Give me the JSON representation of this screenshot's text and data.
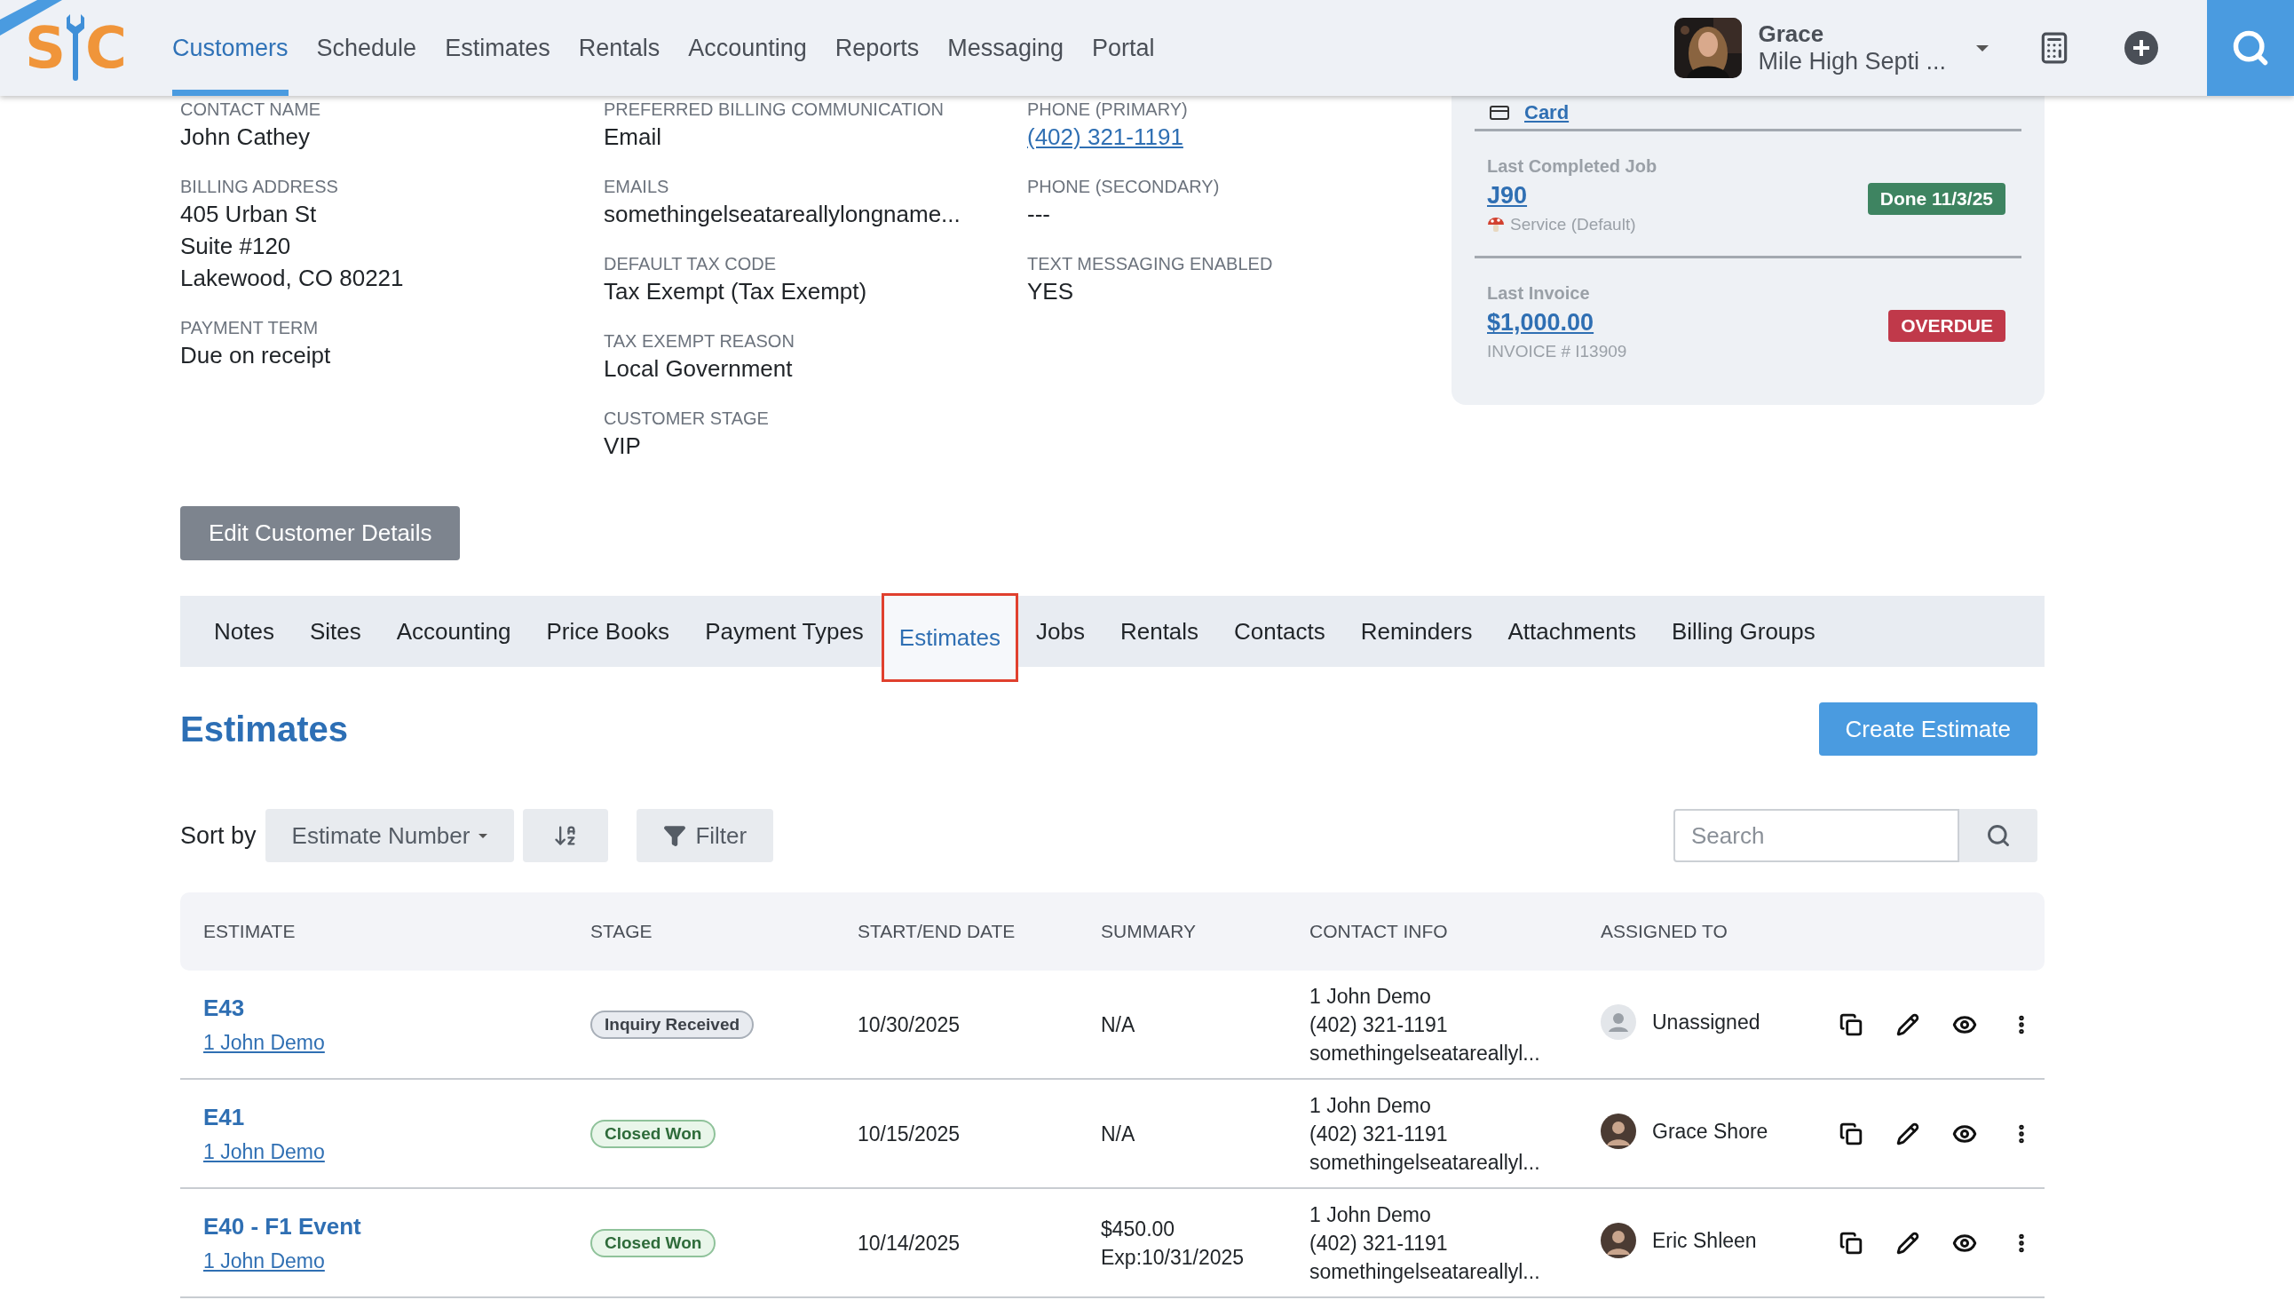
{
  "logo": {
    "left": "S",
    "right": "C"
  },
  "nav": {
    "items": [
      {
        "label": "Customers",
        "selected": true
      },
      {
        "label": "Schedule",
        "selected": false
      },
      {
        "label": "Estimates",
        "selected": false
      },
      {
        "label": "Rentals",
        "selected": false
      },
      {
        "label": "Accounting",
        "selected": false
      },
      {
        "label": "Reports",
        "selected": false
      },
      {
        "label": "Messaging",
        "selected": false
      },
      {
        "label": "Portal",
        "selected": false
      }
    ],
    "user": {
      "name": "Grace",
      "company": "Mile High Septi ..."
    }
  },
  "details": {
    "columns": [
      [
        {
          "label": "CONTACT NAME",
          "kind": "text",
          "lines": [
            "John Cathey"
          ]
        },
        {
          "label": "BILLING ADDRESS",
          "kind": "text",
          "lines": [
            "405 Urban St",
            "Suite #120",
            "Lakewood, CO 80221"
          ]
        },
        {
          "label": "PAYMENT TERM",
          "kind": "text",
          "lines": [
            "Due on receipt"
          ]
        }
      ],
      [
        {
          "label": "PREFERRED BILLING COMMUNICATION",
          "kind": "text",
          "lines": [
            "Email"
          ]
        },
        {
          "label": "EMAILS",
          "kind": "text",
          "lines": [
            "somethingelseatareallylongname..."
          ]
        },
        {
          "label": "DEFAULT TAX CODE",
          "kind": "text",
          "lines": [
            "Tax Exempt (Tax Exempt)"
          ]
        },
        {
          "label": "TAX EXEMPT REASON",
          "kind": "text",
          "lines": [
            "Local Government"
          ]
        },
        {
          "label": "CUSTOMER STAGE",
          "kind": "text",
          "lines": [
            "VIP"
          ]
        }
      ],
      [
        {
          "label": "PHONE (PRIMARY)",
          "kind": "link",
          "lines": [
            "(402) 321-1191"
          ]
        },
        {
          "label": "PHONE (SECONDARY)",
          "kind": "text",
          "lines": [
            "---"
          ]
        },
        {
          "label": "TEXT MESSAGING ENABLED",
          "kind": "text",
          "lines": [
            "YES"
          ]
        }
      ]
    ]
  },
  "summary_panel": {
    "card_link": "Card",
    "sections": [
      {
        "title": "Last Completed Job",
        "link": "J90",
        "detail": "Service (Default)",
        "kind": "job",
        "badge": {
          "label": "Done 11/3/25",
          "kind": "success"
        }
      },
      {
        "title": "Last Invoice",
        "link": "$1,000.00",
        "detail": "INVOICE # I13909",
        "kind": "plain",
        "badge": {
          "label": "OVERDUE",
          "kind": "danger"
        }
      }
    ]
  },
  "edit_button": "Edit Customer Details",
  "tabs": [
    {
      "label": "Notes",
      "selected": false
    },
    {
      "label": "Sites",
      "selected": false
    },
    {
      "label": "Accounting",
      "selected": false
    },
    {
      "label": "Price Books",
      "selected": false
    },
    {
      "label": "Payment Types",
      "selected": false
    },
    {
      "label": "Estimates",
      "selected": true
    },
    {
      "label": "Jobs",
      "selected": false
    },
    {
      "label": "Rentals",
      "selected": false
    },
    {
      "label": "Contacts",
      "selected": false
    },
    {
      "label": "Reminders",
      "selected": false
    },
    {
      "label": "Attachments",
      "selected": false
    },
    {
      "label": "Billing Groups",
      "selected": false
    }
  ],
  "estimates": {
    "title": "Estimates",
    "create_button": "Create Estimate",
    "sort_label": "Sort by",
    "sort_value": "Estimate Number",
    "filter_button": "Filter",
    "search": {
      "placeholder": "Search"
    },
    "table": {
      "columns": [
        "ESTIMATE",
        "STAGE",
        "START/END DATE",
        "SUMMARY",
        "CONTACT INFO",
        "ASSIGNED TO"
      ],
      "rows": [
        {
          "estimate": "E43",
          "customer": "1 John Demo",
          "stage": {
            "label": "Inquiry Received",
            "kind": "inquiry"
          },
          "date": "10/30/2025",
          "summary": [
            "N/A"
          ],
          "contact": [
            "1 John Demo",
            "(402) 321-1191",
            "somethingelseatareallyl..."
          ],
          "assignee": {
            "name": "Unassigned",
            "kind": "none"
          }
        },
        {
          "estimate": "E41",
          "customer": "1 John Demo",
          "stage": {
            "label": "Closed Won",
            "kind": "won"
          },
          "date": "10/15/2025",
          "summary": [
            "N/A"
          ],
          "contact": [
            "1 John Demo",
            "(402) 321-1191",
            "somethingelseatareallyl..."
          ],
          "assignee": {
            "name": "Grace Shore",
            "kind": "person"
          }
        },
        {
          "estimate": "E40 - F1 Event",
          "customer": "1 John Demo",
          "stage": {
            "label": "Closed Won",
            "kind": "won"
          },
          "date": "10/14/2025",
          "summary": [
            "$450.00",
            "Exp:10/31/2025"
          ],
          "contact": [
            "1 John Demo",
            "(402) 321-1191",
            "somethingelseatareallyl..."
          ],
          "assignee": {
            "name": "Eric Shleen",
            "kind": "person"
          }
        }
      ]
    }
  }
}
